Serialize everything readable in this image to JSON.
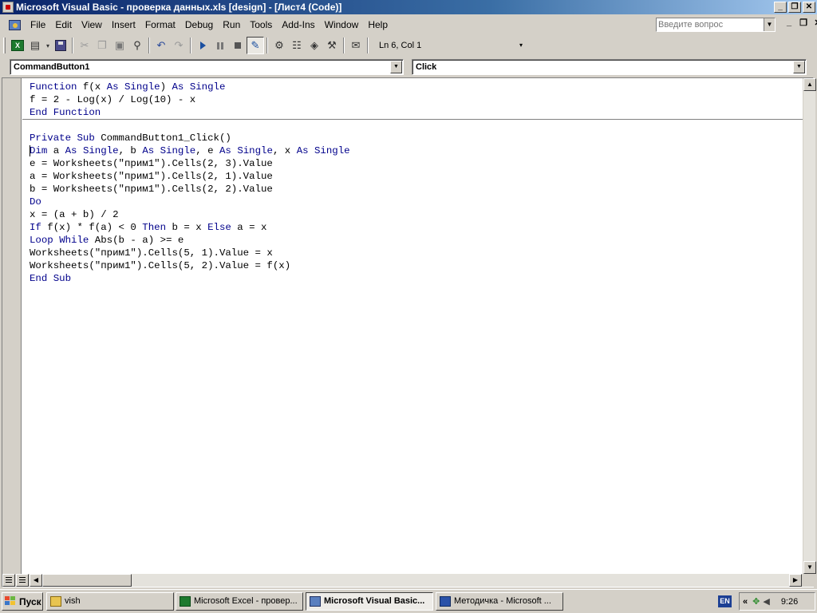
{
  "window": {
    "title": "Microsoft Visual Basic - проверка данных.xls [design] - [Лист4 (Code)]",
    "controls": [
      "_",
      "❐",
      "✕"
    ]
  },
  "menu": {
    "items": [
      "File",
      "Edit",
      "View",
      "Insert",
      "Format",
      "Debug",
      "Run",
      "Tools",
      "Add-Ins",
      "Window",
      "Help"
    ],
    "help_placeholder": "Введите вопрос",
    "doc_controls": [
      "_",
      "❐",
      "✕"
    ]
  },
  "toolbar": {
    "position": "Ln 6, Col 1"
  },
  "combos": {
    "object": "CommandButton1",
    "procedure": "Click"
  },
  "code": {
    "lines": [
      "Function f(x As Single) As Single",
      "f = 2 - Log(x) / Log(10) - x",
      "End Function",
      "",
      "Private Sub CommandButton1_Click()",
      "Dim a As Single, b As Single, e As Single, x As Single",
      "e = Worksheets(\"прим1\").Cells(2, 3).Value",
      "a = Worksheets(\"прим1\").Cells(2, 1).Value",
      "b = Worksheets(\"прим1\").Cells(2, 2).Value",
      "Do",
      "x = (a + b) / 2",
      "If f(x) * f(a) < 0 Then b = x Else a = x",
      "Loop While Abs(b - a) >= e",
      "Worksheets(\"прим1\").Cells(5, 1).Value = x",
      "Worksheets(\"прим1\").Cells(5, 2).Value = f(x)",
      "End Sub"
    ]
  },
  "taskbar": {
    "start": "Пуск",
    "tasks": [
      {
        "label": "vish",
        "icon": "folder-icon"
      },
      {
        "label": "Microsoft Excel - провер...",
        "icon": "excel-icon"
      },
      {
        "label": "Microsoft Visual Basic...",
        "icon": "vb-icon"
      },
      {
        "label": "Методичка - Microsoft ...",
        "icon": "word-icon"
      }
    ],
    "language": "EN",
    "tray_arrows": "«",
    "time": "9:26"
  },
  "colors": {
    "keyword": "#00008b",
    "title_start": "#0a246a",
    "title_end": "#a6caf0",
    "face": "#d4d0c8"
  }
}
